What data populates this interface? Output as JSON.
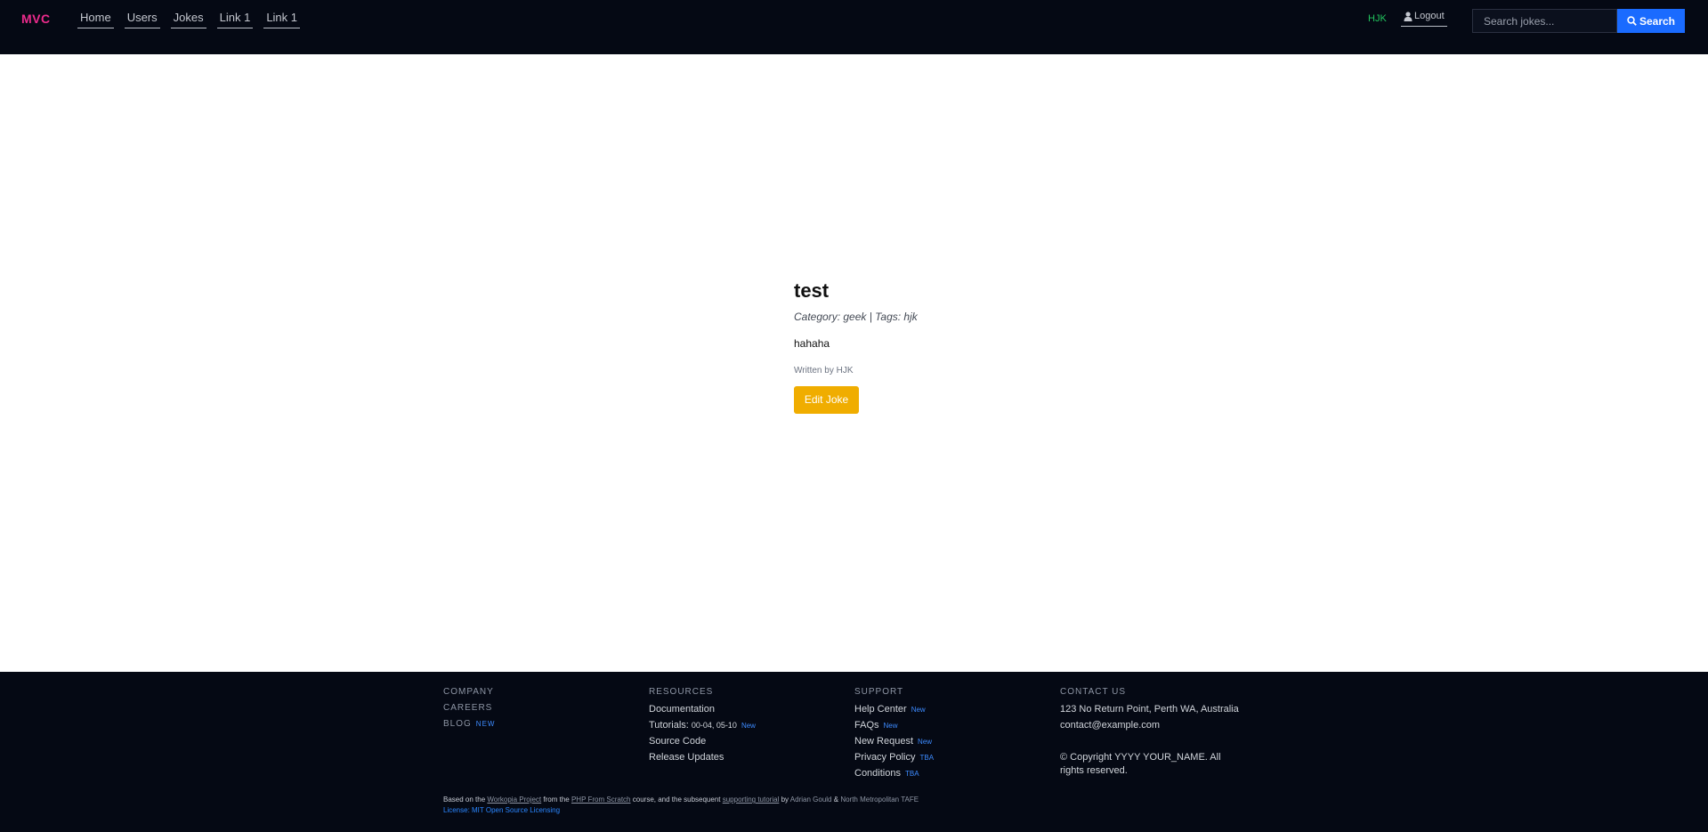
{
  "header": {
    "brand": "MVC",
    "nav": [
      "Home",
      "Users",
      "Jokes",
      "Link 1",
      "Link 1"
    ],
    "user": "HJK",
    "logout_label": "Logout",
    "search_placeholder": "Search jokes...",
    "search_button": "Search"
  },
  "joke": {
    "title": "test",
    "meta": "Category: geek | Tags: hjk",
    "body": "hahaha",
    "author": "Written by HJK",
    "edit_button": "Edit Joke"
  },
  "footer": {
    "company": {
      "items": [
        "COMPANY",
        "CAREERS",
        "BLOG"
      ],
      "blog_badge": "NEW"
    },
    "resources": {
      "heading": "RESOURCES",
      "documentation": "Documentation",
      "tutorials_label": "Tutorials:",
      "tutorials_ranges": "00-04, 05-10",
      "tutorials_badge": "New",
      "source_code": "Source Code",
      "release_updates": "Release Updates"
    },
    "support": {
      "heading": "SUPPORT",
      "items": [
        {
          "label": "Help Center",
          "badge": "New"
        },
        {
          "label": "FAQs",
          "badge": "New"
        },
        {
          "label": "New Request",
          "badge": "New"
        },
        {
          "label": "Privacy Policy",
          "badge": "TBA"
        },
        {
          "label": "Conditions",
          "badge": "TBA"
        }
      ]
    },
    "contact": {
      "heading": "CONTACT US",
      "address": "123 No Return Point, Perth WA, Australia",
      "email": "contact@example.com",
      "copyright": "© Copyright YYYY YOUR_NAME. All rights reserved."
    },
    "credits": {
      "based_on": "Based on the",
      "workopia": "Workopia Project",
      "from_the": "from the",
      "course_link": "PHP From Scratch",
      "course_rest": "course, and the subsequent",
      "tutorial_link": "supporting tutorial",
      "by": "by",
      "author": "Adrian Gould",
      "amp": "&",
      "org": "North Metropolitan TAFE",
      "license": "License: MIT Open Source Licensing"
    }
  }
}
